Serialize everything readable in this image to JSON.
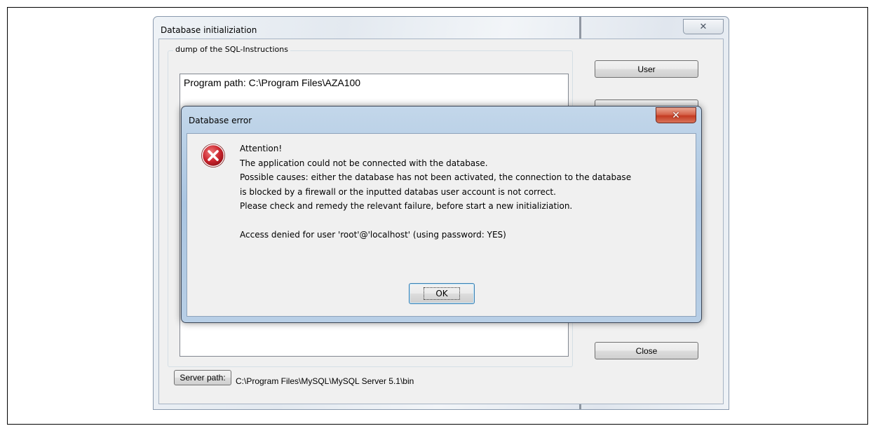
{
  "main_window": {
    "title": "Database initializiation",
    "close_glyph": "✕",
    "group_label": "dump of the SQL-Instructions",
    "log_line": "Program path: C:\\Program Files\\AZA100",
    "buttons": {
      "user": "User",
      "close": "Close",
      "server_path": "Server path:"
    },
    "server_path_value": "C:\\Program Files\\MySQL\\MySQL Server 5.1\\bin"
  },
  "dialog": {
    "title": "Database error",
    "close_glyph": "✕",
    "icon": "error-icon",
    "lines": [
      "Attention!",
      "The application could not be connected with the database.",
      "Possible causes: either the database has not been activated, the connection to the database",
      "is blocked by a firewall or the inputted databas user account is not correct.",
      "Please check and remedy the relevant failure, before start a new initializiation."
    ],
    "detail": "Access denied for user 'root'@'localhost' (using password: YES)",
    "ok_label": "OK"
  },
  "colors": {
    "dialog_frame": "#aac5e1",
    "close_red": "#c43b22",
    "error_icon_red": "#c9232c"
  }
}
